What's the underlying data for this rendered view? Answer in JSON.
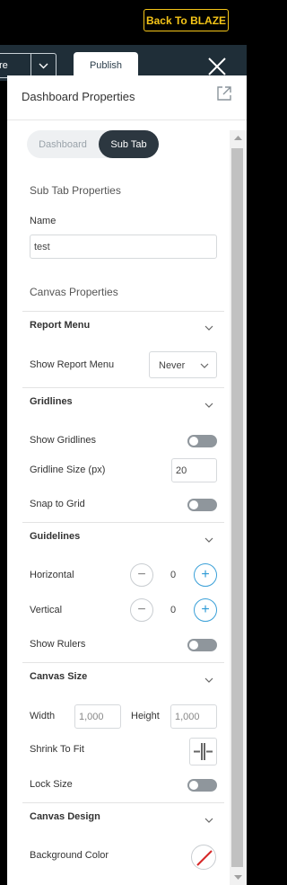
{
  "topbar": {
    "back_button": "Back To BLAZE"
  },
  "toolbar": {
    "left_label": "re",
    "publish_tab": "Publish"
  },
  "panel": {
    "title": "Dashboard Properties",
    "tabs": [
      {
        "label": "Dashboard",
        "active": false
      },
      {
        "label": "Sub Tab",
        "active": true
      }
    ],
    "sub_tab_properties": {
      "heading": "Sub Tab Properties",
      "name_label": "Name",
      "name_value": "test"
    },
    "canvas_properties_heading": "Canvas Properties",
    "report_menu": {
      "title": "Report Menu",
      "show_label": "Show Report Menu",
      "show_value": "Never"
    },
    "gridlines": {
      "title": "Gridlines",
      "show_label": "Show Gridlines",
      "show_value": false,
      "size_label": "Gridline Size (px)",
      "size_value": "20",
      "snap_label": "Snap to Grid",
      "snap_value": false
    },
    "guidelines": {
      "title": "Guidelines",
      "horizontal_label": "Horizontal",
      "horizontal_value": "0",
      "vertical_label": "Vertical",
      "vertical_value": "0",
      "rulers_label": "Show Rulers",
      "rulers_value": false
    },
    "canvas_size": {
      "title": "Canvas Size",
      "width_label": "Width",
      "width_value": "1,000",
      "height_label": "Height",
      "height_value": "1,000",
      "shrink_label": "Shrink To Fit",
      "lock_label": "Lock Size",
      "lock_value": false
    },
    "canvas_design": {
      "title": "Canvas Design",
      "background_label": "Background Color"
    }
  },
  "colors": {
    "accent_yellow": "#f5c518",
    "toolbar_bg": "#1f2e38",
    "active_tab_bg": "#2c3740",
    "stepper_plus": "#2d9ad6",
    "toggle_off": "#8f969c"
  }
}
